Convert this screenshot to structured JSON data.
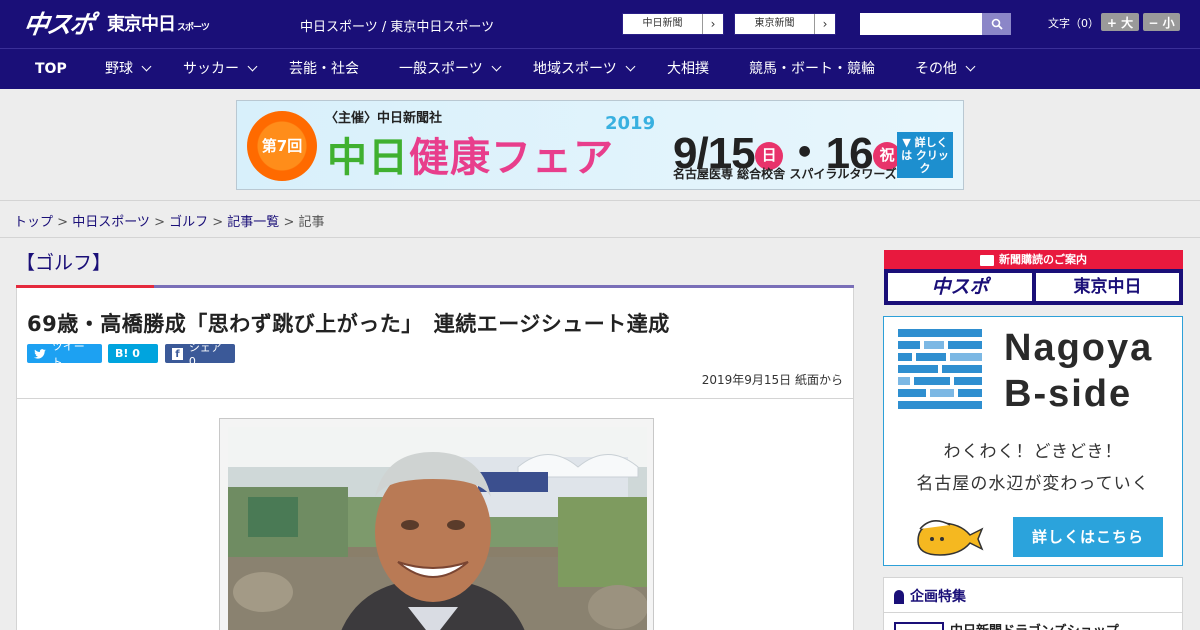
{
  "header": {
    "logo_main": "中スポ",
    "logo_sub": "東京中日",
    "logo_sub_small": "スポーツ",
    "site_links": "中日スポーツ / 東京中日スポーツ",
    "edition_buttons": [
      "中日新聞",
      "東京新聞"
    ],
    "font_size_label": "文字（0）",
    "font_bigger": "+ 大",
    "font_smaller": "− 小"
  },
  "nav": {
    "items": [
      {
        "label": "TOP"
      },
      {
        "label": "野球"
      },
      {
        "label": "サッカー"
      },
      {
        "label": "芸能・社会"
      },
      {
        "label": "一般スポーツ"
      },
      {
        "label": "地域スポーツ"
      },
      {
        "label": "大相撲"
      },
      {
        "label": "競馬・ボート・競輪"
      },
      {
        "label": "その他"
      }
    ]
  },
  "banner": {
    "badge": "第7回",
    "host": "〈主催〉中日新聞社",
    "title_a": "中日",
    "title_b": "健康フェア",
    "year": "2019",
    "date": "9/15",
    "day1": "日",
    "date2": "・16",
    "day2": "祝",
    "venue": "名古屋医専 総合校舎 スパイラルタワーズ",
    "cta": "▼ 詳しくは クリック"
  },
  "breadcrumb": {
    "items": [
      "トップ",
      "中日スポーツ",
      "ゴルフ",
      "記事一覧"
    ],
    "current": "記事"
  },
  "article": {
    "category": "【ゴルフ】",
    "headline": "69歳・高橋勝成「思わず跳び上がった」　連続エージシュート達成",
    "tweet": "ツイート",
    "hatena": "B! 0",
    "share": "シェア 0",
    "date": "2019年9月15日 紙面から"
  },
  "sidebar": {
    "subscribe_title": "新聞購読のご案内",
    "subscribe_a": "中スポ",
    "subscribe_b": "東京中日",
    "ad_title_1": "Nagoya",
    "ad_title_2": "B-side",
    "ad_copy_1": "わくわく！どきどき！",
    "ad_copy_2": "名古屋の水辺が変わっていく",
    "ad_button": "詳しくはこちら",
    "feature_heading": "企画特集",
    "feature_item": "中日新聞ドラゴンズショップ"
  },
  "colors": {
    "brand": "#1a0f78",
    "accent_red": "#e52a3d",
    "ad_blue": "#2ba3dc"
  }
}
